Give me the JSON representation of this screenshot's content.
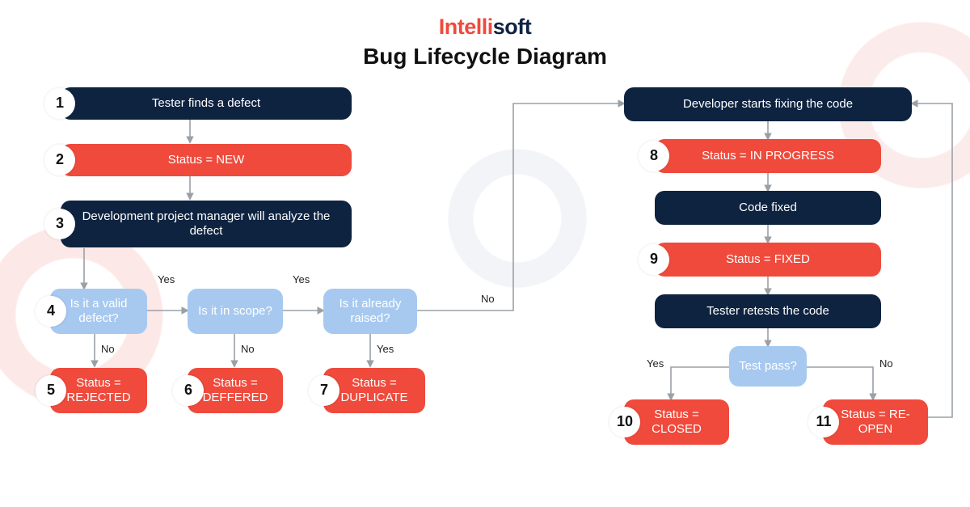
{
  "brand": {
    "part1": "Intelli",
    "part2": "soft"
  },
  "title": "Bug Lifecycle Diagram",
  "labels": {
    "yes": "Yes",
    "no": "No"
  },
  "steps": {
    "s1": {
      "num": "1",
      "text": "Tester finds a defect"
    },
    "s2": {
      "num": "2",
      "text": "Status = NEW"
    },
    "s3": {
      "num": "3",
      "text": "Development project manager will analyze the defect"
    },
    "s4": {
      "num": "4",
      "text": "Is it a valid defect?"
    },
    "s5": {
      "num": "5",
      "text": "Status = REJECTED"
    },
    "s6": {
      "num": "6",
      "text": "Is it in scope?"
    },
    "s6b": {
      "text": "Status = DEFFERED",
      "num": "6"
    },
    "s7a": {
      "text": "Is it already raised?"
    },
    "s7": {
      "num": "7",
      "text": "Status = DUPLICATE"
    },
    "dev": {
      "text": "Developer starts fixing the code"
    },
    "s8": {
      "num": "8",
      "text": "Status = IN PROGRESS"
    },
    "cf": {
      "text": "Code fixed"
    },
    "s9": {
      "num": "9",
      "text": "Status = FIXED"
    },
    "tr": {
      "text": "Tester retests the code"
    },
    "tp": {
      "text": "Test pass?"
    },
    "s10": {
      "num": "10",
      "text": "Status = CLOSED"
    },
    "s11": {
      "num": "11",
      "text": "Status = RE-OPEN"
    }
  }
}
